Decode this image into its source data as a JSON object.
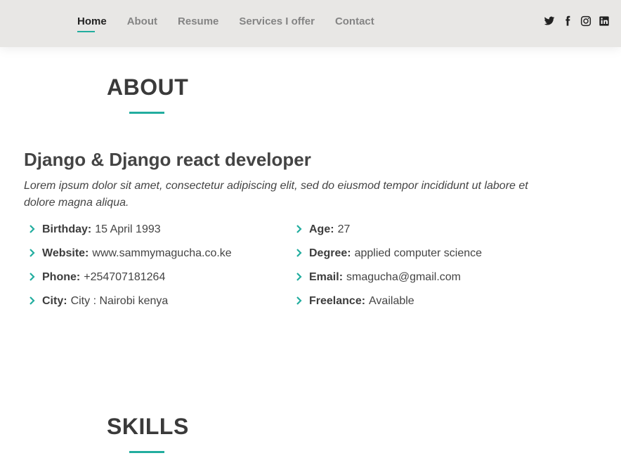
{
  "nav": {
    "items": [
      {
        "label": "Home"
      },
      {
        "label": "About"
      },
      {
        "label": "Resume"
      },
      {
        "label": "Services I offer"
      },
      {
        "label": "Contact"
      }
    ],
    "active": "Home"
  },
  "social": {
    "icons": [
      "twitter-icon",
      "facebook-icon",
      "instagram-icon",
      "linkedin-icon"
    ]
  },
  "about": {
    "title": "ABOUT",
    "headline": "Django & Django react developer",
    "intro": "Lorem ipsum dolor sit amet, consectetur adipiscing elit, sed do eiusmod tempor incididunt ut labore et dolore magna aliqua.",
    "left": [
      {
        "label": "Birthday:",
        "value": "15 April 1993"
      },
      {
        "label": "Website:",
        "value": "www.sammymagucha.co.ke"
      },
      {
        "label": "Phone:",
        "value": "+254707181264"
      },
      {
        "label": "City:",
        "value": "City : Nairobi kenya"
      }
    ],
    "right": [
      {
        "label": "Age:",
        "value": "27"
      },
      {
        "label": "Degree:",
        "value": "applied computer science"
      },
      {
        "label": "Email:",
        "value": "smagucha@gmail.com"
      },
      {
        "label": "Freelance:",
        "value": "Available"
      }
    ]
  },
  "skills": {
    "title": "SKILLS"
  },
  "colors": {
    "accent": "#22ad9f",
    "header_bg": "#e8e7e5",
    "text": "#444444"
  }
}
